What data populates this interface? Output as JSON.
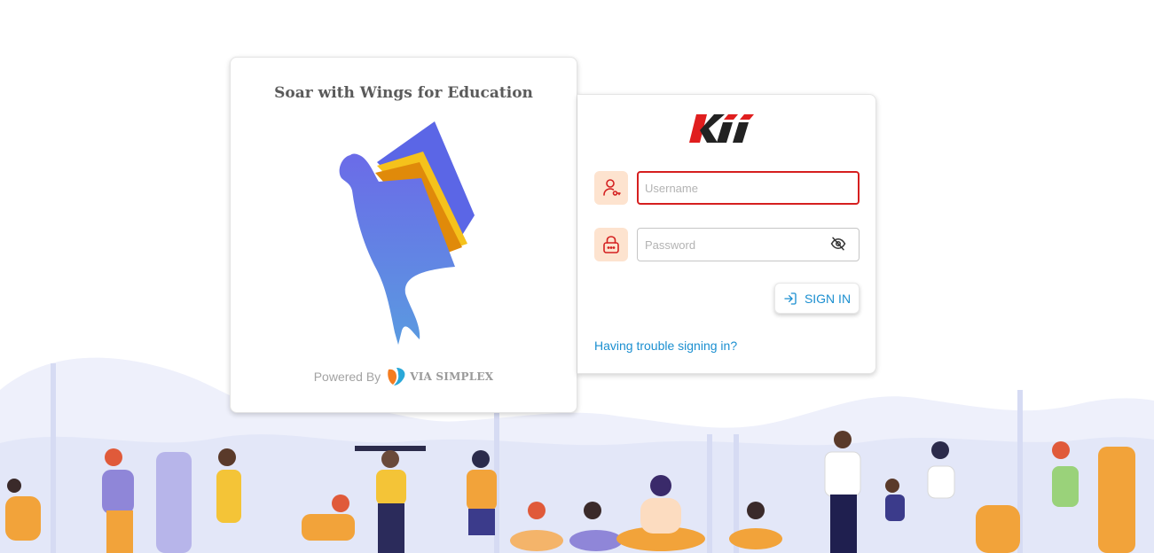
{
  "left_card": {
    "tagline": "Soar with Wings for Education",
    "powered_by_label": "Powered By",
    "powered_by_brand": "VIA SIMPLEX"
  },
  "login": {
    "logo_text": "Kii",
    "username": {
      "placeholder": "Username",
      "value": ""
    },
    "password": {
      "placeholder": "Password",
      "value": ""
    },
    "sign_in_label": "SIGN IN",
    "trouble_link": "Having trouble signing in?"
  },
  "icons": {
    "username": "user-key-icon",
    "password": "lock-icon",
    "toggle_password": "eye-off-icon",
    "sign_in": "login-arrow-icon"
  },
  "colors": {
    "accent_blue": "#1b8fd0",
    "error_red": "#d61f1f",
    "icon_tile": "#fde3cf",
    "icon_red": "#d42020",
    "kii_red": "#e01e1e",
    "kii_black": "#222222"
  }
}
